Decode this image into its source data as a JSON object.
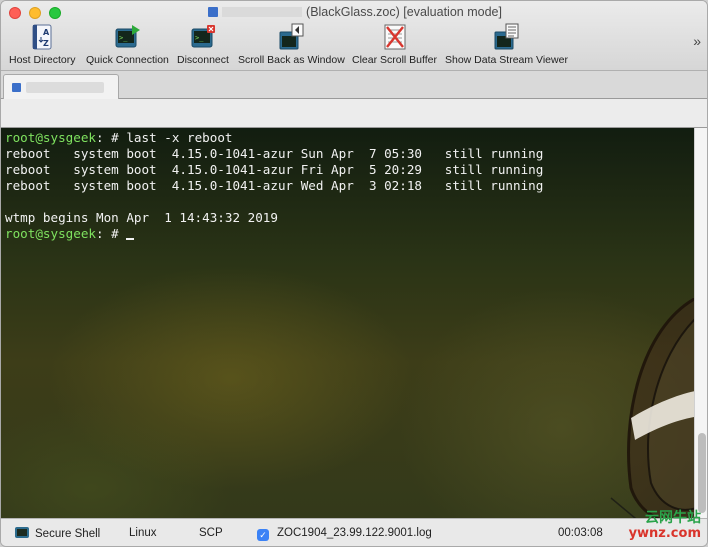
{
  "window": {
    "title": "(BlackGlass.zoc) [evaluation mode]"
  },
  "toolbar": {
    "host_directory": "Host Directory",
    "quick_connection": "Quick Connection",
    "disconnect": "Disconnect",
    "scroll_back_as_window": "Scroll Back as Window",
    "clear_scroll_buffer": "Clear Scroll Buffer",
    "show_data_stream_viewer": "Show Data Stream Viewer",
    "overflow": "»"
  },
  "terminal": {
    "prompt": "root@sysgeek",
    "prompt_suffix": ": # ",
    "command": "last -x reboot",
    "rows": [
      "reboot   system boot  4.15.0-1041-azur Sun Apr  7 05:30   still running",
      "reboot   system boot  4.15.0-1041-azur Fri Apr  5 20:29   still running",
      "reboot   system boot  4.15.0-1041-azur Wed Apr  3 02:18   still running"
    ],
    "wtmp_line": "wtmp begins Mon Apr  1 14:43:32 2019"
  },
  "status": {
    "session": "Secure Shell",
    "emulation": "Linux",
    "transfer": "SCP",
    "log_file": "ZOC1904_23.99.122.9001.log",
    "log_checked": "✓",
    "timer": "00:03:08",
    "watermark_line1": "云网牛站",
    "watermark_line2": "ywnz.com"
  },
  "colors": {
    "prompt": "#7fe25f",
    "terminal_text": "#f2f2f2"
  }
}
